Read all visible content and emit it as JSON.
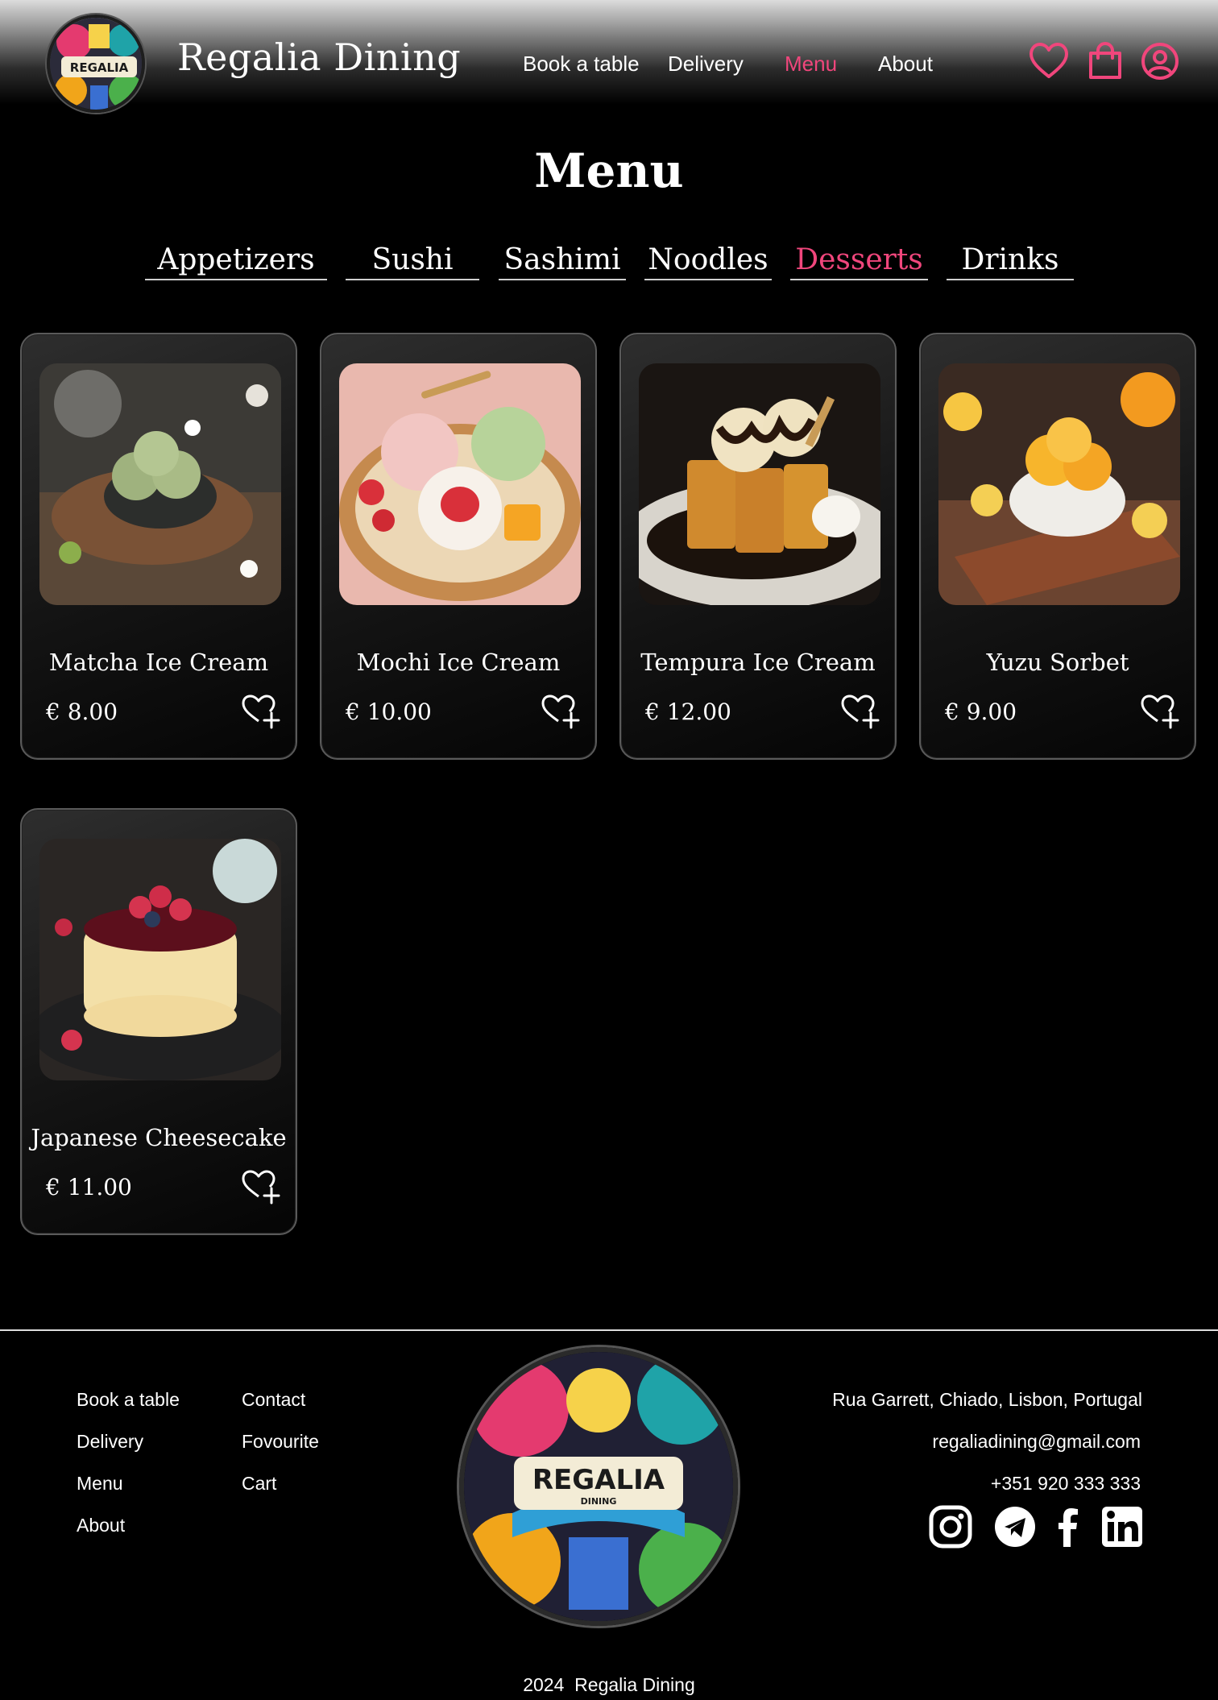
{
  "header": {
    "brand": "Regalia Dining",
    "logo_text": "REGALIA",
    "nav": [
      {
        "label": "Book a table",
        "active": false
      },
      {
        "label": "Delivery",
        "active": false
      },
      {
        "label": "Menu",
        "active": true
      },
      {
        "label": "About",
        "active": false
      }
    ],
    "icons": [
      "heart-icon",
      "shopping-bag-icon",
      "user-account-icon"
    ],
    "accent_color": "#f0467c"
  },
  "page": {
    "title": "Menu",
    "tabs": [
      {
        "label": "Appetizers",
        "active": false
      },
      {
        "label": "Sushi",
        "active": false
      },
      {
        "label": "Sashimi",
        "active": false
      },
      {
        "label": "Noodles",
        "active": false
      },
      {
        "label": "Desserts",
        "active": true
      },
      {
        "label": "Drinks",
        "active": false
      }
    ]
  },
  "items": [
    {
      "name": "Matcha Ice Cream",
      "price": "€ 8.00"
    },
    {
      "name": "Mochi Ice Cream",
      "price": "€ 10.00"
    },
    {
      "name": "Tempura Ice Cream",
      "price": "€ 12.00"
    },
    {
      "name": "Yuzu Sorbet",
      "price": "€ 9.00"
    },
    {
      "name": "Japanese Cheesecake",
      "price": "€ 11.00"
    }
  ],
  "footer": {
    "links_col1": [
      "Book a table",
      "Delivery",
      "Menu",
      "About"
    ],
    "links_col2": [
      "Contact",
      "Fovourite",
      "Cart"
    ],
    "logo_text": "REGALIA",
    "logo_subtext": "DINING",
    "address": "Rua Garrett, Chiado, Lisbon, Portugal",
    "email": "regaliadining@gmail.com",
    "phone": "+351 920 333 333",
    "social": [
      "instagram-icon",
      "telegram-icon",
      "facebook-icon",
      "linkedin-icon"
    ],
    "copyright": "2024  Regalia Dining"
  }
}
